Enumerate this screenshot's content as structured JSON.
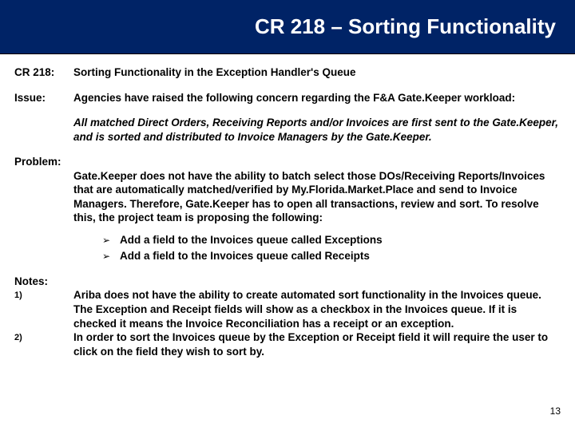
{
  "title": "CR 218 – Sorting Functionality",
  "header": {
    "label": "CR 218:",
    "text": "Sorting Functionality in the Exception Handler's Queue"
  },
  "issue": {
    "label": "Issue:",
    "text": "Agencies have raised the following concern regarding the F&A Gate.Keeper workload:",
    "detail": "All matched Direct Orders, Receiving Reports and/or Invoices are first sent to the Gate.Keeper, and is sorted and distributed to Invoice Managers by the Gate.Keeper."
  },
  "problem": {
    "label": "Problem:",
    "text": "Gate.Keeper does not have the ability to batch select those DOs/Receiving Reports/Invoices that are automatically matched/verified by My.Florida.Market.Place and send to Invoice Managers.  Therefore, Gate.Keeper has to open all transactions, review and sort. To resolve this, the project team is proposing the following:"
  },
  "bullets": [
    "Add a field to the Invoices queue called Exceptions",
    "Add a field to the Invoices queue called Receipts"
  ],
  "notes": {
    "label": "Notes:",
    "items": [
      {
        "num": "1)",
        "text": "Ariba does not have the ability to create automated sort functionality in the Invoices queue.  The Exception and Receipt fields will show as a checkbox in the Invoices queue.  If it is checked it means the Invoice Reconciliation has a receipt or an exception."
      },
      {
        "num": "2)",
        "text": "In order to sort the Invoices queue by the Exception or Receipt field it will require the user to click on the field they wish to sort by."
      }
    ]
  },
  "page_number": "13",
  "arrow_glyph": "➢"
}
